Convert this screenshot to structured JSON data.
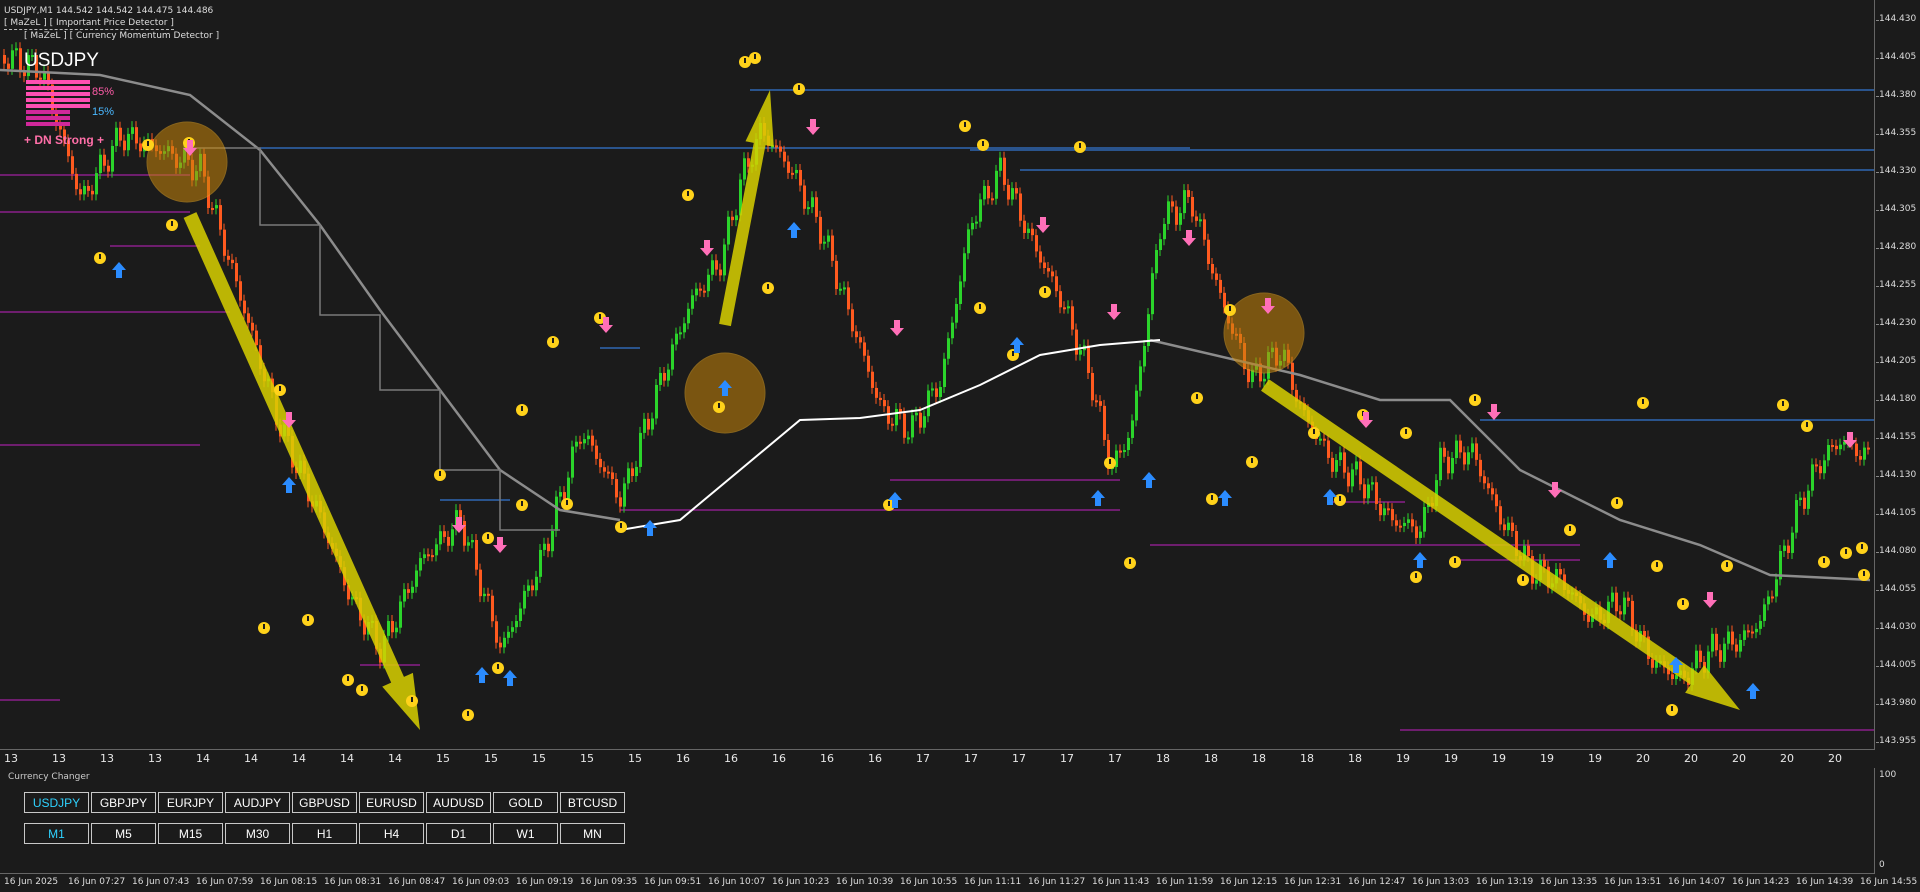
{
  "header": {
    "symbol_line": "USDJPY,M1  144.542 144.542 144.475 144.486",
    "indicator_1": "[ MaZeL ] [ Important Price Detector ]",
    "indicator_2": "[ MaZeL ] [ Currency Momentum Detector ]"
  },
  "momentum": {
    "symbol": "USDJPY",
    "upper_pct": "85%",
    "lower_pct": "15%",
    "signal": "+ DN Strong +",
    "colors": {
      "pink": "#ff5ca8",
      "magenta": "#e020c8",
      "blue": "#4ab8ff"
    }
  },
  "price_axis": {
    "labels": [
      "144.430",
      "144.405",
      "144.380",
      "144.355",
      "144.330",
      "144.305",
      "144.280",
      "144.255",
      "144.230",
      "144.205",
      "144.180",
      "144.155",
      "144.130",
      "144.105",
      "144.080",
      "144.055",
      "144.030",
      "144.005",
      "143.980",
      "143.955"
    ]
  },
  "day_axis": {
    "labels": [
      "13",
      "13",
      "13",
      "13",
      "14",
      "14",
      "14",
      "14",
      "14",
      "15",
      "15",
      "15",
      "15",
      "15",
      "16",
      "16",
      "16",
      "16",
      "16",
      "17",
      "17",
      "17",
      "17",
      "17",
      "18",
      "18",
      "18",
      "18",
      "18",
      "19",
      "19",
      "19",
      "19",
      "19",
      "20",
      "20",
      "20",
      "20",
      "20"
    ]
  },
  "sub_window": {
    "title": "Currency Changer",
    "pairs": [
      "USDJPY",
      "GBPJPY",
      "EURJPY",
      "AUDJPY",
      "GBPUSD",
      "EURUSD",
      "AUDUSD",
      "GOLD",
      "BTCUSD"
    ],
    "active_pair": "USDJPY",
    "timeframes": [
      "M1",
      "M5",
      "M15",
      "M30",
      "H1",
      "H4",
      "D1",
      "W1",
      "MN"
    ],
    "active_timeframe": "M1",
    "axis_top": "100",
    "axis_bottom": "0"
  },
  "time_axis": {
    "labels": [
      "16 Jun 2025",
      "16 Jun 07:27",
      "16 Jun 07:43",
      "16 Jun 07:59",
      "16 Jun 08:15",
      "16 Jun 08:31",
      "16 Jun 08:47",
      "16 Jun 09:03",
      "16 Jun 09:19",
      "16 Jun 09:35",
      "16 Jun 09:51",
      "16 Jun 10:07",
      "16 Jun 10:23",
      "16 Jun 10:39",
      "16 Jun 10:55",
      "16 Jun 11:11",
      "16 Jun 11:27",
      "16 Jun 11:43",
      "16 Jun 11:59",
      "16 Jun 12:15",
      "16 Jun 12:31",
      "16 Jun 12:47",
      "16 Jun 13:03",
      "16 Jun 13:19",
      "16 Jun 13:35",
      "16 Jun 13:51",
      "16 Jun 14:07",
      "16 Jun 14:23",
      "16 Jun 14:39",
      "16 Jun 14:55"
    ]
  },
  "colors": {
    "background": "#1b1b1b",
    "bull_candle": "#2bd42b",
    "bear_candle": "#ff5a1f",
    "grey_trend": "#8c8c8c",
    "arrow_yellow": "#d8d000",
    "level_blue": "#3a8cff",
    "level_magenta": "#c020c0",
    "up_arrow": "#2b8cff",
    "down_arrow": "#ff6fb8",
    "fractal_yellow": "#ffd21a"
  }
}
